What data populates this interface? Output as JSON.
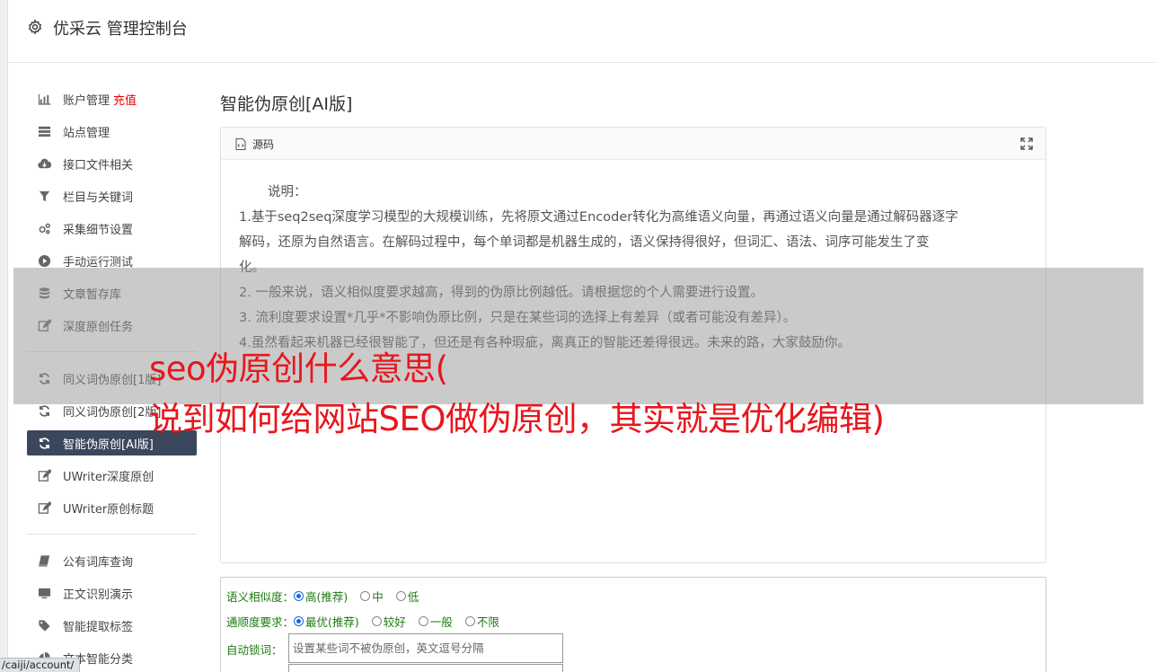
{
  "header": {
    "title": "优采云 管理控制台"
  },
  "sidebar": {
    "groups": [
      [
        {
          "label": "账户管理",
          "badge": "充值",
          "icon": "bar-chart-icon"
        },
        {
          "label": "站点管理",
          "icon": "server-icon"
        },
        {
          "label": "接口文件相关",
          "icon": "cloud-download-icon"
        },
        {
          "label": "栏目与关键词",
          "icon": "filter-icon"
        },
        {
          "label": "采集细节设置",
          "icon": "gears-icon"
        },
        {
          "label": "手动运行测试",
          "icon": "play-icon"
        },
        {
          "label": "文章暂存库",
          "icon": "database-icon"
        },
        {
          "label": "深度原创任务",
          "icon": "edit-icon"
        }
      ],
      [
        {
          "label": "同义词伪原创[1版]",
          "icon": "refresh-icon"
        },
        {
          "label": "同义词伪原创[2版]",
          "icon": "refresh-icon"
        },
        {
          "label": "智能伪原创[AI版]",
          "icon": "refresh-icon",
          "active": true
        },
        {
          "label": "UWriter深度原创",
          "icon": "edit-icon"
        },
        {
          "label": "UWriter原创标题",
          "icon": "edit-icon"
        }
      ],
      [
        {
          "label": "公有词库查询",
          "icon": "book-icon"
        },
        {
          "label": "正文识别演示",
          "icon": "monitor-icon"
        },
        {
          "label": "智能提取标签",
          "icon": "tag-icon"
        },
        {
          "label": "文本智能分类",
          "icon": "pie-chart-icon"
        }
      ]
    ]
  },
  "main": {
    "title": "智能伪原创[AI版]",
    "panel": {
      "header_label": "源码",
      "lines": [
        "说明：",
        "1.基于seq2seq深度学习模型的大规模训练，先将原文通过Encoder转化为高维语义向量，再通过语义向量是通过解码器逐字",
        "解码，还原为自然语言。在解码过程中，每个单词都是机器生成的，语义保持得很好，但词汇、语法、词序可能发生了变",
        "化。",
        "2. 一般来说，语义相似度要求越高，得到的伪原比例越低。请根据您的个人需要进行设置。",
        "3. 流利度要求设置*几乎*不影响伪原比例，只是在某些词的选择上有差异（或者可能没有差异）。",
        "4.虽然看起来机器已经很智能了，但还是有各种瑕疵，离真正的智能还差得很远。未来的路，大家鼓励你。"
      ]
    },
    "form": {
      "similarity": {
        "label": "语义相似度：",
        "options": [
          "高(推荐)",
          "中",
          "低"
        ],
        "selected": 0
      },
      "fluency": {
        "label": "通顺度要求：",
        "options": [
          "最优(推荐)",
          "较好",
          "一般",
          "不限"
        ],
        "selected": 0
      },
      "lock": {
        "label": "自动锁词：",
        "placeholder": "设置某些词不被伪原创，英文逗号分隔"
      }
    }
  },
  "overlay": {
    "headline_line1": "seo伪原创什么意思(",
    "headline_line2": "说到如何给网站SEO做伪原创，其实就是优化编辑)"
  },
  "statusbar": {
    "url": "/caiji/account/"
  }
}
